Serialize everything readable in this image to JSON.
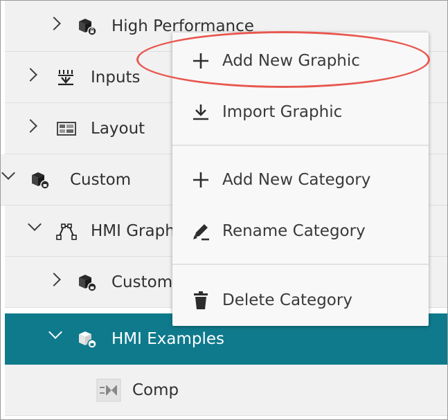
{
  "tree": {
    "rows": [
      {
        "label": "High Performance",
        "icon": "category-icon",
        "expanded": false
      },
      {
        "label": "Inputs",
        "icon": "inputs-icon",
        "expanded": false
      },
      {
        "label": "Layout",
        "icon": "layout-icon",
        "expanded": false
      },
      {
        "label": "Custom",
        "icon": "category-icon",
        "expanded": true
      },
      {
        "label": "HMI Graph",
        "icon": "hmi-graphics-icon",
        "expanded": true
      },
      {
        "label": "Custom",
        "icon": "category-icon",
        "expanded": false
      },
      {
        "label": "HMI Examples",
        "icon": "category-icon",
        "expanded": true,
        "selected": true
      },
      {
        "label": "Comp",
        "icon": "component-icon"
      }
    ]
  },
  "context_menu": {
    "items": [
      {
        "label": "Add New Graphic",
        "icon": "plus-icon"
      },
      {
        "label": "Import Graphic",
        "icon": "import-icon"
      },
      {
        "label": "Add New Category",
        "icon": "plus-icon"
      },
      {
        "label": "Rename Category",
        "icon": "rename-icon"
      },
      {
        "label": "Delete Category",
        "icon": "trash-icon"
      }
    ]
  },
  "colors": {
    "selected_row": "#0f7a8c",
    "highlight_ellipse": "#e8584f",
    "row_background": "#f1f1f1",
    "menu_background": "#f8f8f8"
  }
}
